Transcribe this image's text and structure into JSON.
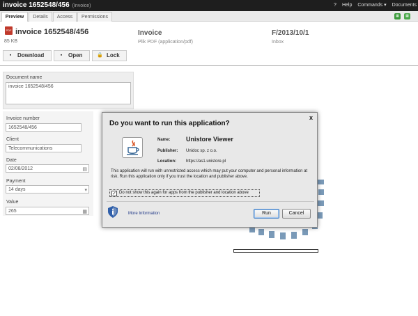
{
  "window": {
    "title": "invoice 1652548/456",
    "subtitle": "(Invoice)",
    "menu": {
      "info": "?",
      "help": "Help",
      "commands": "Commands ▾",
      "documents": "Documents"
    }
  },
  "tabs": [
    "Preview",
    "Details",
    "Access",
    "Permissions"
  ],
  "header": {
    "title": "invoice 1652548/456",
    "size": "85 KB",
    "type_title": "Invoice",
    "type_sub": "Plik PDF (application/pdf)",
    "folder_title": "F/2013/10/1",
    "folder_sub": "Inbox"
  },
  "toolbar": {
    "download": "Download",
    "open": "Open",
    "lock": "Lock"
  },
  "form": {
    "document_name_label": "Document name",
    "document_name_value": "invoice 1652548/456",
    "invoice_number_label": "Invoice number",
    "invoice_number_value": "1652548/456",
    "client_label": "Client",
    "client_value": "Telecommunications",
    "date_label": "Date",
    "date_value": "02/08/2012",
    "payment_label": "Payment",
    "payment_value": "14 days",
    "value_label": "Value",
    "value_value": "265"
  },
  "dialog": {
    "title": "Do you want to run this application?",
    "close": "x",
    "name_label": "Name:",
    "name_value": "Unistore Viewer",
    "publisher_label": "Publisher:",
    "publisher_value": "Unidoc sp. z o.o.",
    "location_label": "Location:",
    "location_value": "https://as1.unistore.pl",
    "warning": "This application will run with unrestricted access which may put your computer and personal information at risk. Run this application only if you trust the location and publisher above.",
    "checkbox_label": "Do not show this again for apps from the publisher and location above",
    "more_info": "More Information",
    "run": "Run",
    "cancel": "Cancel"
  },
  "colors": {
    "topbar": "#1e1e1e",
    "spinner": "#7a9ab8",
    "link": "#223a88",
    "pdf": "#c0392b"
  }
}
